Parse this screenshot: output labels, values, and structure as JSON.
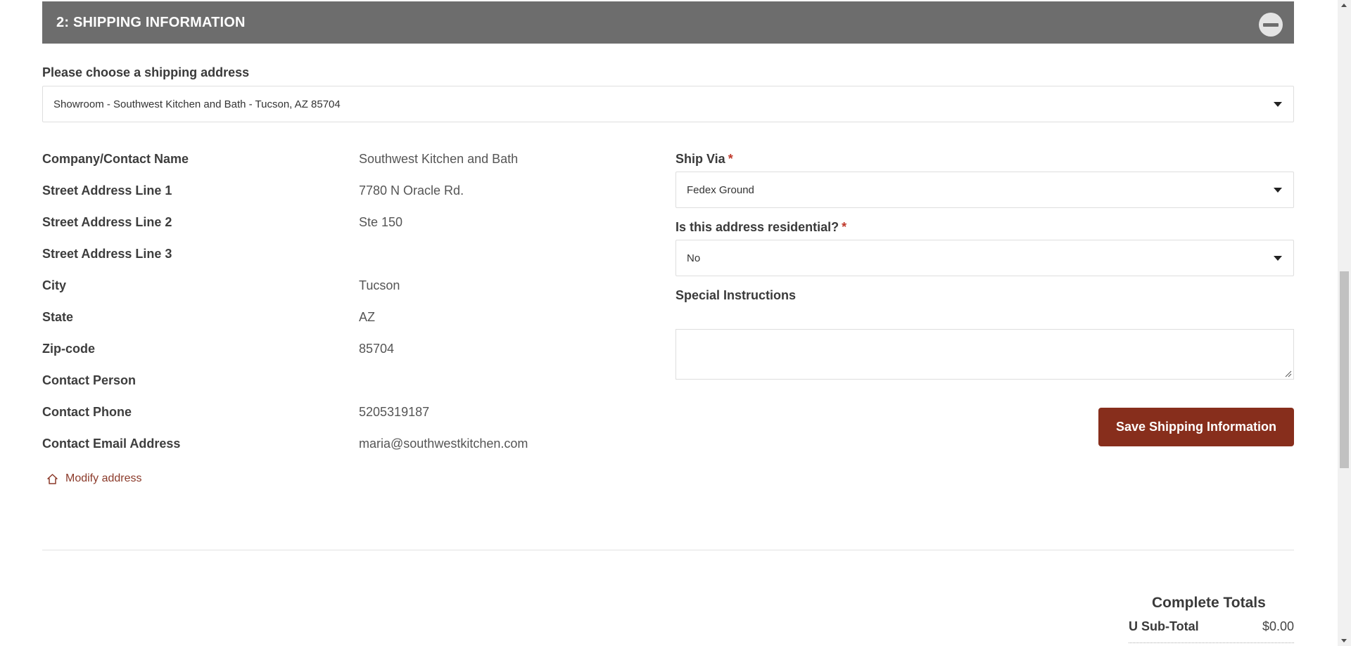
{
  "section": {
    "title": "2: SHIPPING INFORMATION",
    "collapse_icon": "minus-circle-icon"
  },
  "address_chooser": {
    "label": "Please choose a shipping address",
    "selected": "Showroom - Southwest Kitchen and Bath - Tucson, AZ 85704"
  },
  "address_details": [
    {
      "label": "Company/Contact Name",
      "value": "Southwest Kitchen and Bath"
    },
    {
      "label": "Street Address Line 1",
      "value": "7780 N Oracle Rd."
    },
    {
      "label": "Street Address Line 2",
      "value": "Ste 150"
    },
    {
      "label": "Street Address Line 3",
      "value": ""
    },
    {
      "label": "City",
      "value": "Tucson"
    },
    {
      "label": "State",
      "value": "AZ"
    },
    {
      "label": "Zip-code",
      "value": "85704"
    },
    {
      "label": "Contact Person",
      "value": ""
    },
    {
      "label": "Contact Phone",
      "value": "5205319187"
    },
    {
      "label": "Contact Email Address",
      "value": "maria@southwestkitchen.com"
    }
  ],
  "modify_link": {
    "label": "Modify address",
    "icon": "home-icon"
  },
  "form": {
    "ship_via": {
      "label": "Ship Via",
      "required_mark": "*",
      "selected": "Fedex Ground"
    },
    "residential": {
      "label": "Is this address residential?",
      "required_mark": "*",
      "selected": "No"
    },
    "special_instructions": {
      "label": "Special Instructions",
      "value": ""
    },
    "save_label": "Save Shipping Information"
  },
  "totals": {
    "title": "Complete Totals",
    "subtotal_label": "U Sub-Total",
    "subtotal_value": "$0.00"
  },
  "colors": {
    "header_bg": "#6d6d6d",
    "accent": "#872e1c",
    "link": "#8b3a2a",
    "required": "#c0392b"
  }
}
